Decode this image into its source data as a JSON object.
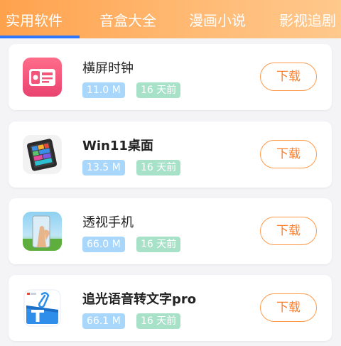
{
  "tabs": [
    {
      "label": "实用软件"
    },
    {
      "label": "音盒大全"
    },
    {
      "label": "漫画小说"
    },
    {
      "label": "影视追剧"
    }
  ],
  "accent_color": "#2f76ff",
  "header_gradient": [
    "#ffa24d",
    "#ffc88c"
  ],
  "apps": [
    {
      "name": "横屏时钟",
      "size": "11.0 M",
      "updated": "16 天前",
      "download_label": "下载",
      "icon": "clock-app-icon"
    },
    {
      "name": "Win11桌面",
      "size": "13.5 M",
      "updated": "16 天前",
      "download_label": "下载",
      "icon": "tablet-app-icon"
    },
    {
      "name": "透视手机",
      "size": "66.0 M",
      "updated": "16 天前",
      "download_label": "下载",
      "icon": "phone-app-icon"
    },
    {
      "name": "追光语音转文字pro",
      "size": "66.1 M",
      "updated": "16 天前",
      "download_label": "下载",
      "icon": "text-document-app-icon"
    }
  ]
}
